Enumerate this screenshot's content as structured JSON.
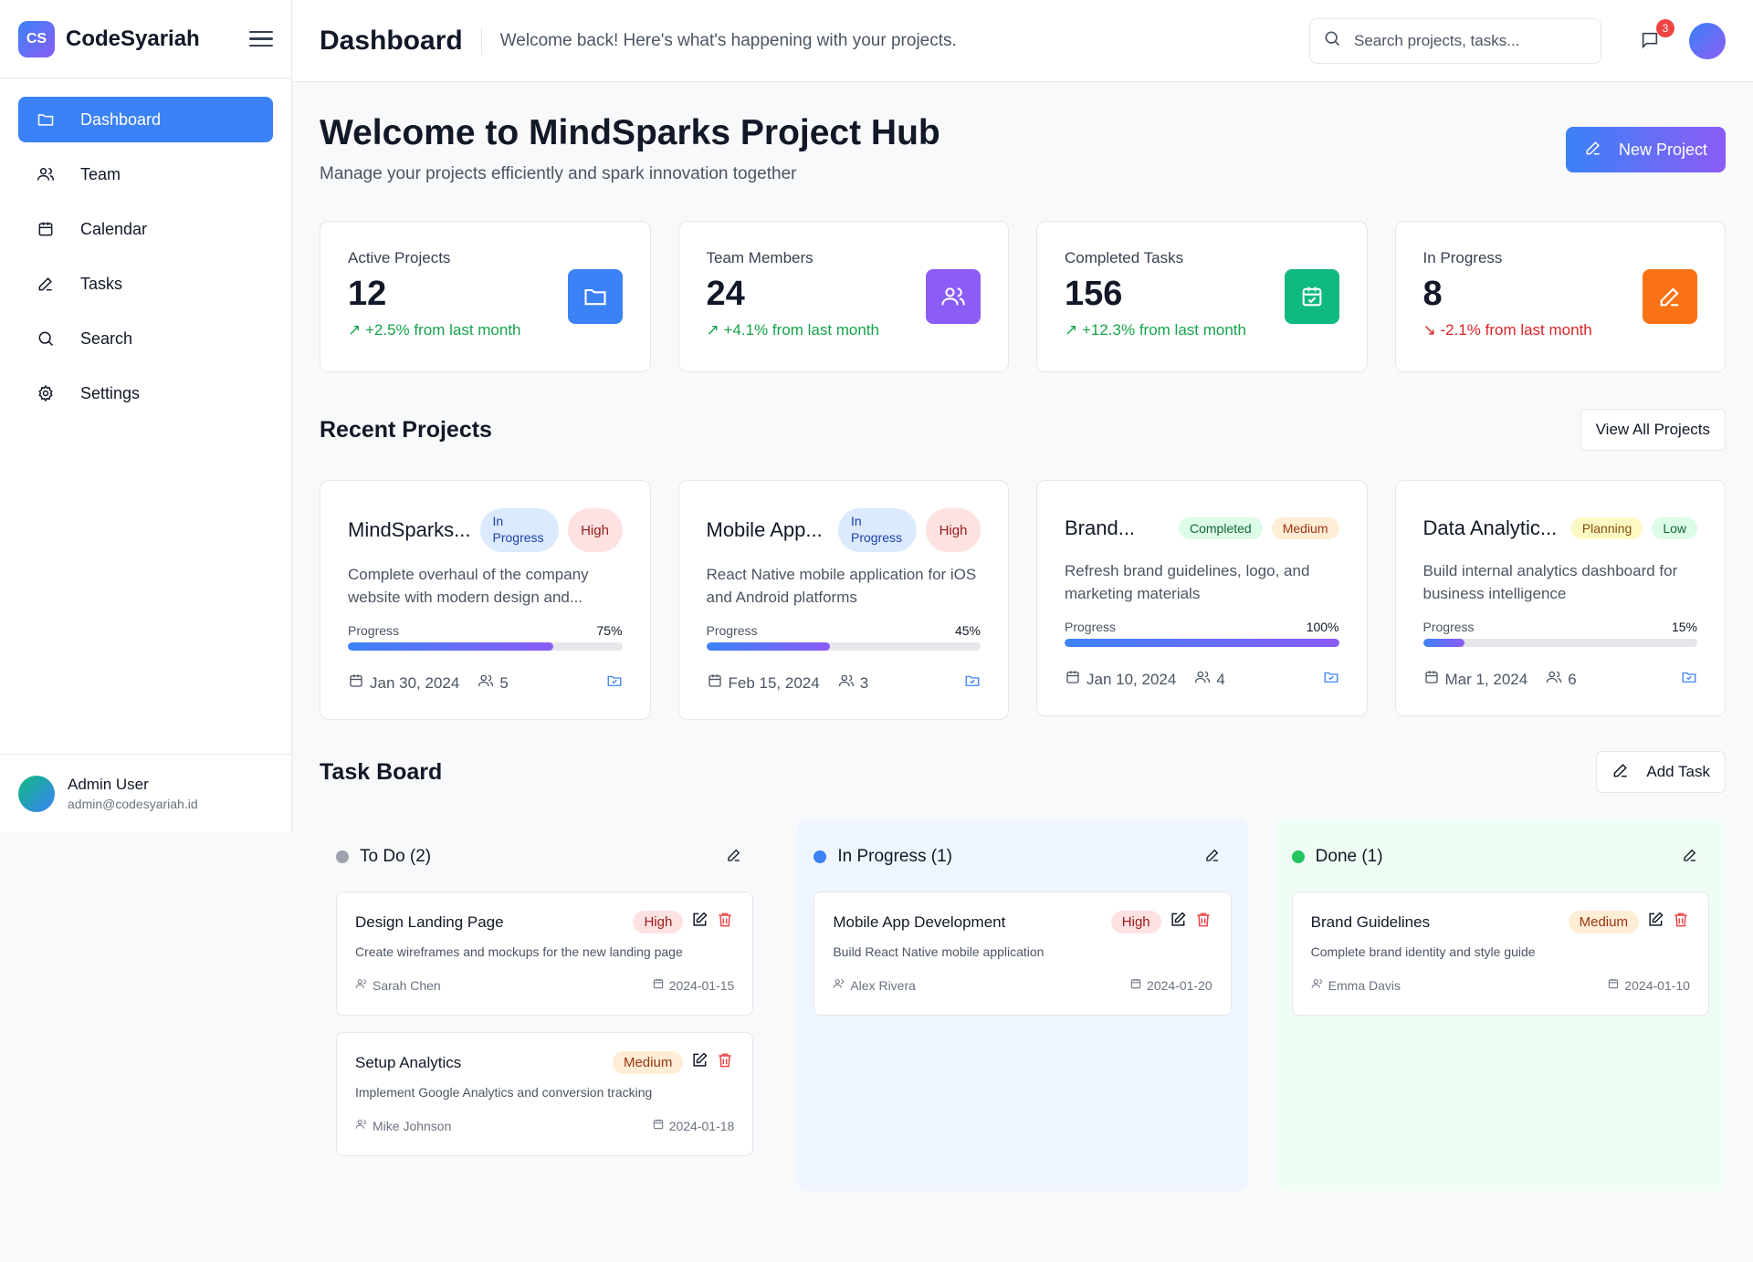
{
  "brand": {
    "logo": "CS",
    "name": "CodeSyariah"
  },
  "sidebar": {
    "items": [
      {
        "label": "Dashboard",
        "icon": "folder-icon",
        "active": true
      },
      {
        "label": "Team",
        "icon": "users-icon"
      },
      {
        "label": "Calendar",
        "icon": "calendar-icon"
      },
      {
        "label": "Tasks",
        "icon": "pencil-icon"
      },
      {
        "label": "Search",
        "icon": "search-icon"
      },
      {
        "label": "Settings",
        "icon": "gear-icon"
      }
    ],
    "user": {
      "name": "Admin User",
      "email": "admin@codesyariah.id"
    }
  },
  "header": {
    "title": "Dashboard",
    "subtitle": "Welcome back! Here's what's happening with your projects.",
    "search_placeholder": "Search projects, tasks...",
    "notification_count": "3"
  },
  "welcome": {
    "title": "Welcome to MindSparks Project Hub",
    "subtitle": "Manage your projects efficiently and spark innovation together",
    "new_project_label": "New Project"
  },
  "stats": [
    {
      "label": "Active Projects",
      "value": "12",
      "change": "↗ +2.5% from last month",
      "trend": "up",
      "color": "#3b82f6",
      "icon": "folder-icon"
    },
    {
      "label": "Team Members",
      "value": "24",
      "change": "↗ +4.1% from last month",
      "trend": "up",
      "color": "#8b5cf6",
      "icon": "users-icon"
    },
    {
      "label": "Completed Tasks",
      "value": "156",
      "change": "↗ +12.3% from last month",
      "trend": "up",
      "color": "#10b981",
      "icon": "calendar-check-icon"
    },
    {
      "label": "In Progress",
      "value": "8",
      "change": "↘ -2.1% from last month",
      "trend": "down",
      "color": "#f97316",
      "icon": "pencil-icon"
    }
  ],
  "recent": {
    "title": "Recent Projects",
    "view_all_label": "View All Projects",
    "progress_label": "Progress",
    "projects": [
      {
        "name": "MindSparks...",
        "status": "In Progress",
        "priority": "High",
        "description": "Complete overhaul of the company website with modern design and...",
        "progress": 75,
        "progress_text": "75%",
        "date": "Jan 30, 2024",
        "members": "5"
      },
      {
        "name": "Mobile App...",
        "status": "In Progress",
        "priority": "High",
        "description": "React Native mobile application for iOS and Android platforms",
        "progress": 45,
        "progress_text": "45%",
        "date": "Feb 15, 2024",
        "members": "3"
      },
      {
        "name": "Brand...",
        "status": "Completed",
        "priority": "Medium",
        "description": "Refresh brand guidelines, logo, and marketing materials",
        "progress": 100,
        "progress_text": "100%",
        "date": "Jan 10, 2024",
        "members": "4"
      },
      {
        "name": "Data Analytic...",
        "status": "Planning",
        "priority": "Low",
        "description": "Build internal analytics dashboard for business intelligence",
        "progress": 15,
        "progress_text": "15%",
        "date": "Mar 1, 2024",
        "members": "6"
      }
    ]
  },
  "board": {
    "title": "Task Board",
    "add_task_label": "Add Task",
    "columns": [
      {
        "title": "To Do (2)",
        "dot": "#9ca3af",
        "bg": "transparent",
        "tasks": [
          {
            "title": "Design Landing Page",
            "priority": "High",
            "description": "Create wireframes and mockups for the new landing page",
            "assignee": "Sarah Chen",
            "date": "2024-01-15"
          },
          {
            "title": "Setup Analytics",
            "priority": "Medium",
            "description": "Implement Google Analytics and conversion tracking",
            "assignee": "Mike Johnson",
            "date": "2024-01-18"
          }
        ]
      },
      {
        "title": "In Progress (1)",
        "dot": "#3b82f6",
        "bg": "#eff6ff",
        "tasks": [
          {
            "title": "Mobile App Development",
            "priority": "High",
            "description": "Build React Native mobile application",
            "assignee": "Alex Rivera",
            "date": "2024-01-20"
          }
        ]
      },
      {
        "title": "Done (1)",
        "dot": "#22c55e",
        "bg": "#f0fdf4",
        "tasks": [
          {
            "title": "Brand Guidelines",
            "priority": "Medium",
            "description": "Complete brand identity and style guide",
            "assignee": "Emma Davis",
            "date": "2024-01-10"
          }
        ]
      }
    ]
  }
}
